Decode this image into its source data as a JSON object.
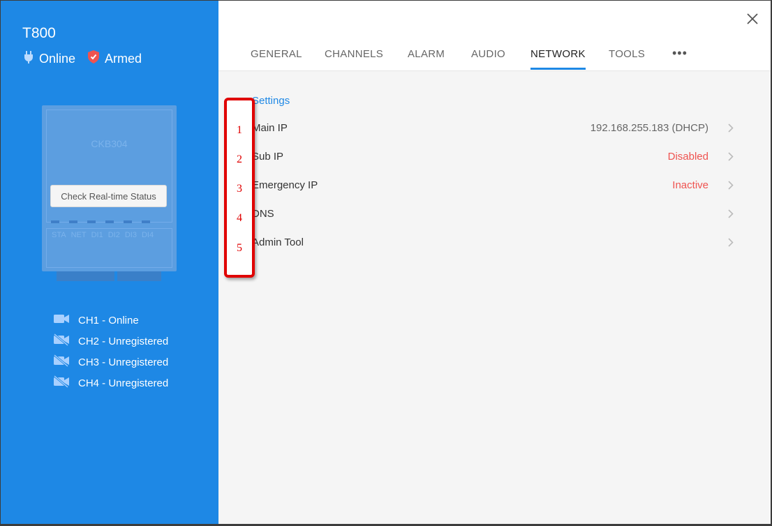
{
  "device": {
    "name": "T800",
    "online_label": "Online",
    "armed_label": "Armed",
    "model": "CKB304",
    "check_status_label": "Check Real-time Status",
    "ports": [
      "STA",
      "NET",
      "DI1",
      "DI2",
      "DI3",
      "DI4"
    ]
  },
  "channels": [
    {
      "label": "CH1 - Online",
      "icon": "video-camera-icon"
    },
    {
      "label": "CH2 - Unregistered",
      "icon": "video-camera-off-icon"
    },
    {
      "label": "CH3 - Unregistered",
      "icon": "video-camera-off-icon"
    },
    {
      "label": "CH4 - Unregistered",
      "icon": "video-camera-off-icon"
    }
  ],
  "tabs": [
    "GENERAL",
    "CHANNELS",
    "ALARM",
    "AUDIO",
    "NETWORK",
    "TOOLS"
  ],
  "active_tab": "NETWORK",
  "more_label": "•••",
  "settings": {
    "title": "Settings",
    "rows": [
      {
        "label": "Main IP",
        "value": "192.168.255.183 (DHCP)"
      },
      {
        "label": "Sub IP",
        "value": "Disabled"
      },
      {
        "label": "Emergency IP",
        "value": "Inactive"
      },
      {
        "label": "DNS",
        "value": ""
      },
      {
        "label": "Admin Tool",
        "value": ""
      }
    ]
  },
  "annotations": [
    "1",
    "2",
    "3",
    "4",
    "5"
  ],
  "colors": {
    "sidebar": "#1e88e5",
    "accent": "#1e88e5",
    "alert": "#ef5350",
    "annotation": "#e00000"
  }
}
